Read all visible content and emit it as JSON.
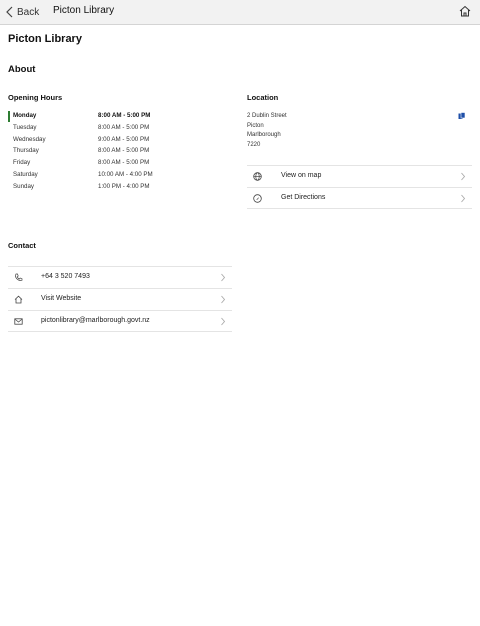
{
  "nav": {
    "back_label": "Back",
    "title": "Picton Library"
  },
  "page": {
    "title": "Picton Library",
    "about_heading": "About"
  },
  "hours": {
    "heading": "Opening Hours",
    "rows": [
      {
        "day": "Monday",
        "time": "8:00 AM - 5:00 PM",
        "today": true
      },
      {
        "day": "Tuesday",
        "time": "8:00 AM - 5:00 PM"
      },
      {
        "day": "Wednesday",
        "time": "9:00 AM - 5:00 PM"
      },
      {
        "day": "Thursday",
        "time": "8:00 AM - 5:00 PM"
      },
      {
        "day": "Friday",
        "time": "8:00 AM - 5:00 PM"
      },
      {
        "day": "Saturday",
        "time": "10:00 AM - 4:00 PM"
      },
      {
        "day": "Sunday",
        "time": "1:00 PM - 4:00 PM"
      }
    ],
    "today_color": "#2e7d32"
  },
  "location": {
    "heading": "Location",
    "address_lines": [
      "2 Dublin Street",
      "Picton",
      "Marlborough",
      "7220"
    ],
    "actions": [
      {
        "label": "View on map",
        "icon": "globe-icon"
      },
      {
        "label": "Get Directions",
        "icon": "directions-icon"
      }
    ]
  },
  "contact": {
    "heading": "Contact",
    "rows": [
      {
        "label": "+64 3 520 7493",
        "icon": "phone-icon"
      },
      {
        "label": "Visit Website",
        "icon": "home-icon"
      },
      {
        "label": "pictonlibrary@marlborough.govt.nz",
        "icon": "mail-icon"
      }
    ]
  },
  "colors": {
    "accent_icon": "#1f4fa8"
  }
}
